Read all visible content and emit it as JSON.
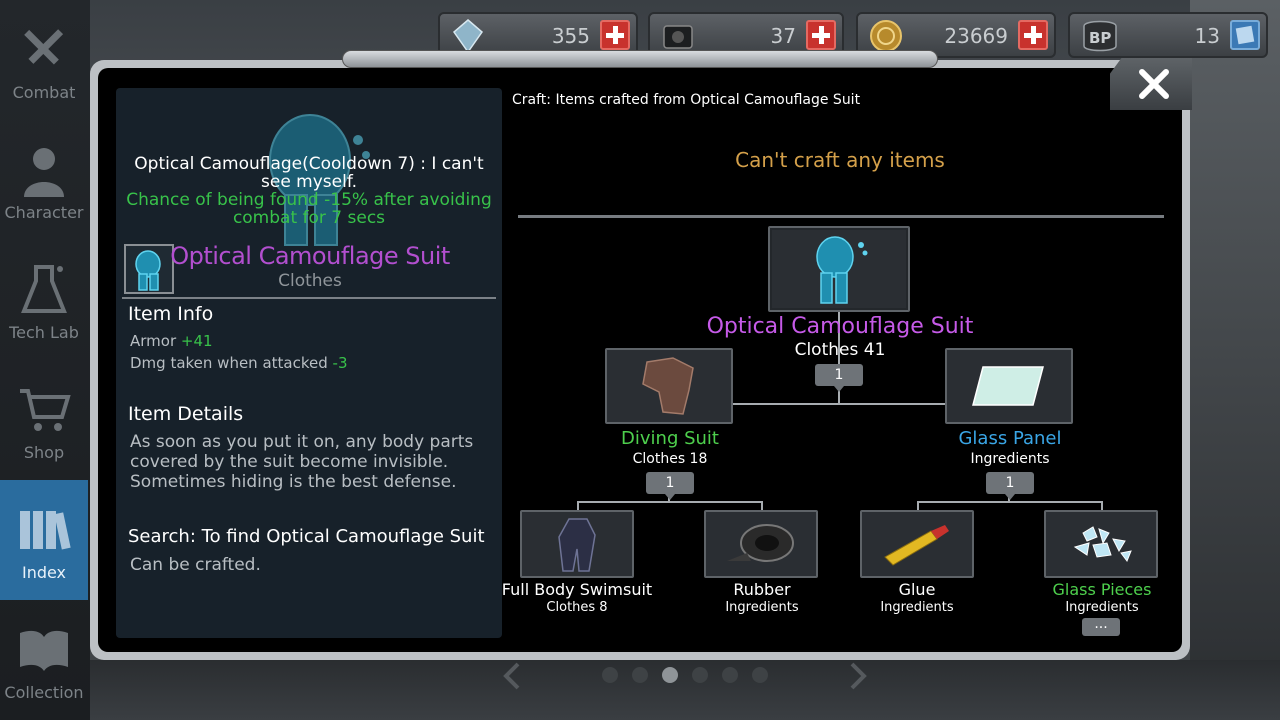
{
  "sidebar": {
    "items": [
      {
        "label": "Combat",
        "icon": "combat-icon"
      },
      {
        "label": "Character",
        "icon": "character-icon"
      },
      {
        "label": "Tech Lab",
        "icon": "flask-icon"
      },
      {
        "label": "Shop",
        "icon": "cart-icon"
      },
      {
        "label": "Index",
        "icon": "books-icon",
        "active": true
      },
      {
        "label": "Collection",
        "icon": "book-icon"
      }
    ]
  },
  "currency": [
    {
      "icon": "crystal-icon",
      "value": "355"
    },
    {
      "icon": "drive-icon",
      "value": "37"
    },
    {
      "icon": "coin-icon",
      "value": "23669"
    },
    {
      "icon": "bp-icon",
      "value": "13"
    }
  ],
  "item": {
    "effect_line1": "Optical Camouflage(Cooldown 7) : I can't see myself.",
    "effect_line2": "Chance of being found -15% after avoiding combat for 7 secs",
    "name": "Optical Camouflage Suit",
    "type": "Clothes",
    "info_title": "Item Info",
    "armor_label": "Armor",
    "armor_value": "+41",
    "dmg_label": "Dmg taken when attacked",
    "dmg_value": "-3",
    "details_title": "Item Details",
    "details_text": "As soon as you put it on, any body parts covered by the suit become invisible. Sometimes hiding is the best defense.",
    "search_text": "Search: To find Optical Camouflage Suit",
    "craftable_text": "Can be crafted."
  },
  "craft": {
    "header": "Craft: Items crafted from Optical Camouflage Suit",
    "status": "Can't craft any items",
    "root": {
      "name": "Optical Camouflage Suit",
      "sub": "Clothes 41",
      "count": "1"
    },
    "left": {
      "name": "Diving Suit",
      "sub": "Clothes 18",
      "count": "1"
    },
    "right": {
      "name": "Glass Panel",
      "sub": "Ingredients",
      "count": "1"
    },
    "leaves": [
      {
        "name": "Full Body Swimsuit",
        "sub": "Clothes 8"
      },
      {
        "name": "Rubber",
        "sub": "Ingredients"
      },
      {
        "name": "Glue",
        "sub": "Ingredients"
      },
      {
        "name": "Glass Pieces",
        "sub": "Ingredients"
      }
    ],
    "more": "..."
  },
  "colors": {
    "accent_active": "#2a6c9e",
    "item_purple": "#c65ae8",
    "green": "#4ed04d",
    "blue": "#3aa6e6",
    "warning": "#d4a04a"
  }
}
